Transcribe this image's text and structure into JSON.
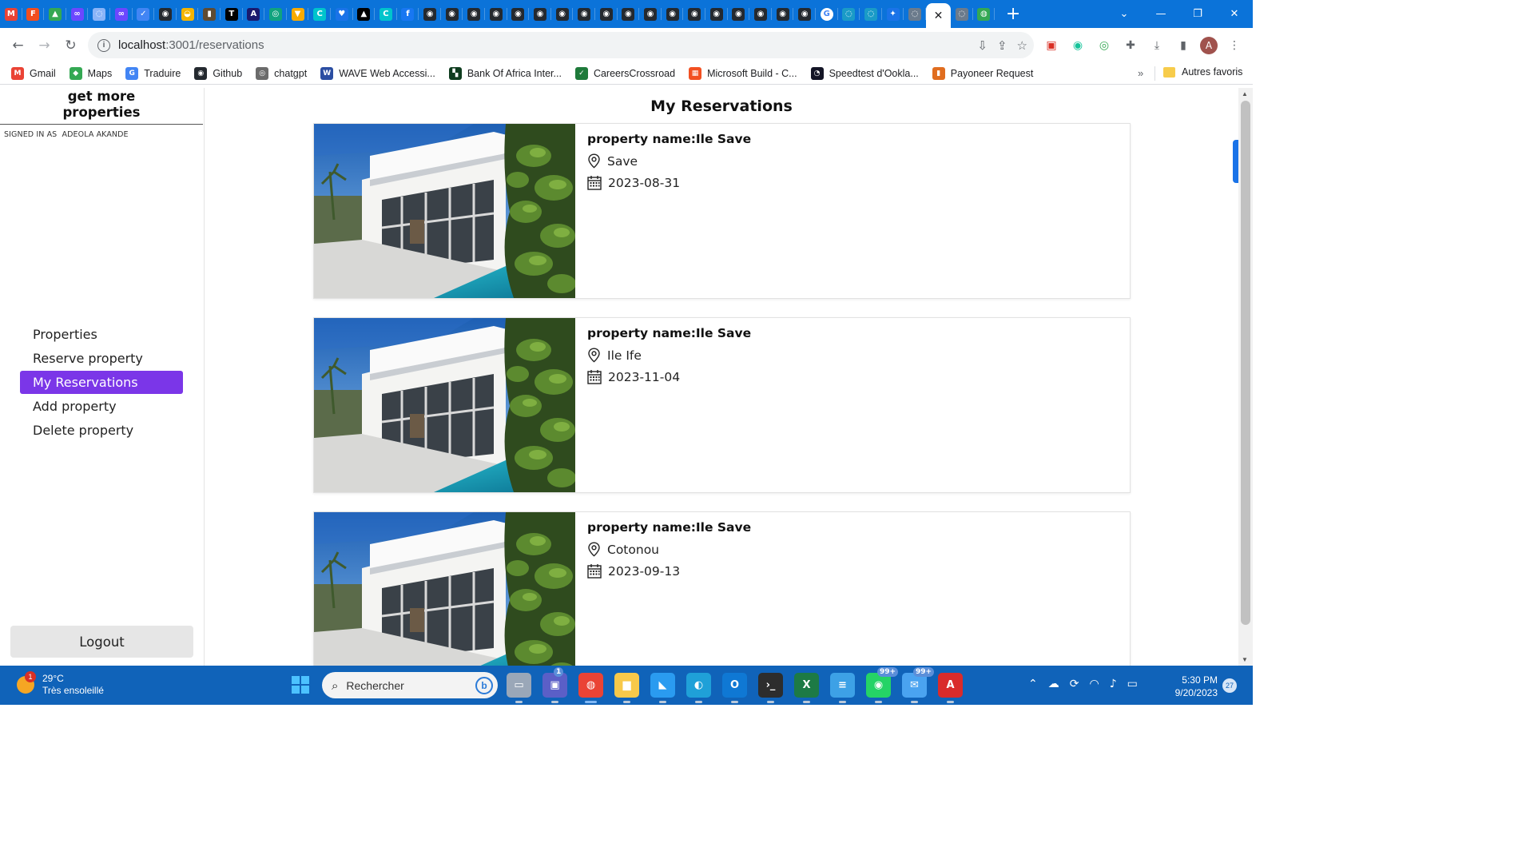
{
  "browser": {
    "url_host": "localhost",
    "url_path": ":3001/reservations",
    "tab_favicons": [
      {
        "icon": "gmail-icon",
        "color": "#ea4335",
        "glyph": "M"
      },
      {
        "icon": "figma-icon",
        "color": "#f24e1e",
        "glyph": "F"
      },
      {
        "icon": "drive-icon",
        "color": "#34a853",
        "glyph": "▲"
      },
      {
        "icon": "meta-icon",
        "color": "#6c47ff",
        "glyph": "∞"
      },
      {
        "icon": "globe-icon",
        "color": "#8ab4f8",
        "glyph": "◌"
      },
      {
        "icon": "meta-icon",
        "color": "#6c47ff",
        "glyph": "∞"
      },
      {
        "icon": "app-icon",
        "color": "#4285f4",
        "glyph": "✓"
      },
      {
        "icon": "github-icon",
        "color": "#24292f",
        "glyph": "◉"
      },
      {
        "icon": "app-icon",
        "color": "#f4b400",
        "glyph": "◒"
      },
      {
        "icon": "book-icon",
        "color": "#5f4b32",
        "glyph": "▮"
      },
      {
        "icon": "text-icon",
        "color": "#000000",
        "glyph": "T"
      },
      {
        "icon": "app-icon",
        "color": "#1a1a6e",
        "glyph": "A"
      },
      {
        "icon": "chatgpt-icon",
        "color": "#10a37f",
        "glyph": "◎"
      },
      {
        "icon": "app-icon",
        "color": "#f9ab00",
        "glyph": "▼"
      },
      {
        "icon": "canva-icon",
        "color": "#00c4cc",
        "glyph": "C"
      },
      {
        "icon": "heart-icon",
        "color": "#1a73e8",
        "glyph": "♥"
      },
      {
        "icon": "app-icon",
        "color": "#000000",
        "glyph": "▲"
      },
      {
        "icon": "canva-icon",
        "color": "#00c4cc",
        "glyph": "C"
      },
      {
        "icon": "facebook-icon",
        "color": "#1877f2",
        "glyph": "f"
      },
      {
        "icon": "github-icon",
        "color": "#24292f",
        "glyph": "◉"
      },
      {
        "icon": "github-icon",
        "color": "#24292f",
        "glyph": "◉"
      },
      {
        "icon": "github-icon",
        "color": "#24292f",
        "glyph": "◉"
      },
      {
        "icon": "github-icon",
        "color": "#24292f",
        "glyph": "◉"
      },
      {
        "icon": "github-icon",
        "color": "#24292f",
        "glyph": "◉"
      },
      {
        "icon": "github-icon",
        "color": "#24292f",
        "glyph": "◉"
      },
      {
        "icon": "github-icon",
        "color": "#24292f",
        "glyph": "◉"
      },
      {
        "icon": "github-icon",
        "color": "#24292f",
        "glyph": "◉"
      },
      {
        "icon": "github-icon",
        "color": "#24292f",
        "glyph": "◉"
      },
      {
        "icon": "github-icon",
        "color": "#24292f",
        "glyph": "◉"
      },
      {
        "icon": "github-icon",
        "color": "#24292f",
        "glyph": "◉"
      },
      {
        "icon": "github-icon",
        "color": "#24292f",
        "glyph": "◉"
      },
      {
        "icon": "github-icon",
        "color": "#24292f",
        "glyph": "◉"
      },
      {
        "icon": "github-icon",
        "color": "#24292f",
        "glyph": "◉"
      },
      {
        "icon": "github-icon",
        "color": "#24292f",
        "glyph": "◉"
      },
      {
        "icon": "github-icon",
        "color": "#24292f",
        "glyph": "◉"
      },
      {
        "icon": "github-icon",
        "color": "#24292f",
        "glyph": "◉"
      },
      {
        "icon": "github-icon",
        "color": "#24292f",
        "glyph": "◉"
      },
      {
        "icon": "google-icon",
        "color": "#ffffff",
        "glyph": "G"
      },
      {
        "icon": "globe-icon",
        "color": "#1a9bc7",
        "glyph": "◌"
      },
      {
        "icon": "globe-icon",
        "color": "#1a9bc7",
        "glyph": "◌"
      },
      {
        "icon": "app-icon",
        "color": "#1a73e8",
        "glyph": "✦"
      },
      {
        "icon": "globe-icon",
        "color": "#6b7b8c",
        "glyph": "◌"
      }
    ],
    "tab_favicons_after": [
      {
        "icon": "globe-icon",
        "color": "#6b7b8c",
        "glyph": "◌"
      },
      {
        "icon": "app-icon",
        "color": "#34a853",
        "glyph": "◍"
      }
    ],
    "active_tab_close": "✕",
    "new_tab": "+",
    "window_controls": {
      "dropdown": "⌄",
      "minimize": "—",
      "restore": "❐",
      "close": "✕"
    },
    "bookmarks": [
      {
        "label": "Gmail",
        "icon": "gmail-icon",
        "color": "#ea4335",
        "glyph": "M"
      },
      {
        "label": "Maps",
        "icon": "maps-icon",
        "color": "#34a853",
        "glyph": "◆"
      },
      {
        "label": "Traduire",
        "icon": "translate-icon",
        "color": "#4285f4",
        "glyph": "G"
      },
      {
        "label": "Github",
        "icon": "github-icon",
        "color": "#24292f",
        "glyph": "◉"
      },
      {
        "label": "chatgpt",
        "icon": "chatgpt-icon",
        "color": "#6b6b6b",
        "glyph": "◎"
      },
      {
        "label": "WAVE Web Accessi...",
        "icon": "wave-icon",
        "color": "#2b4ea2",
        "glyph": "W"
      },
      {
        "label": "Bank Of Africa Inter...",
        "icon": "bank-icon",
        "color": "#0f3d1f",
        "glyph": "▚"
      },
      {
        "label": "CareersCrossroad",
        "icon": "careers-icon",
        "color": "#1e7a3a",
        "glyph": "✓"
      },
      {
        "label": "Microsoft Build - C...",
        "icon": "microsoft-icon",
        "color": "#f25022",
        "glyph": "▦"
      },
      {
        "label": "Speedtest d'Ookla...",
        "icon": "speedtest-icon",
        "color": "#141526",
        "glyph": "◔"
      },
      {
        "label": "Payoneer Request",
        "icon": "payoneer-icon",
        "color": "#e06d1f",
        "glyph": "▮"
      }
    ],
    "bookmarks_more": "»",
    "other_bookmarks": "Autres favoris"
  },
  "app": {
    "brand": "get more properties",
    "signed_in_prefix": "SIGNED IN AS",
    "user_name": "ADEOLA AKANDE",
    "menu": [
      {
        "label": "Properties",
        "active": false
      },
      {
        "label": "Reserve property",
        "active": false
      },
      {
        "label": "My Reservations",
        "active": true
      },
      {
        "label": "Add property",
        "active": false
      },
      {
        "label": "Delete property",
        "active": false
      }
    ],
    "logout_label": "Logout",
    "accent_color": "#7b36e8",
    "page_title": "My Reservations",
    "reservations": [
      {
        "name_prefix": "property name:",
        "name": "Ile Save",
        "city": "Save",
        "date": "2023-08-31"
      },
      {
        "name_prefix": "property name:",
        "name": "Ile Save",
        "city": "Ile Ife",
        "date": "2023-11-04"
      },
      {
        "name_prefix": "property name:",
        "name": "Ile Save",
        "city": "Cotonou",
        "date": "2023-09-13"
      }
    ]
  },
  "taskbar": {
    "weather_badge": "1",
    "temperature": "29°C",
    "condition": "Très ensoleillé",
    "search_placeholder": "Rechercher",
    "apps": [
      {
        "name": "task-view-icon",
        "color": "#9aa7b8",
        "glyph": "▭",
        "running": false
      },
      {
        "name": "teams-icon",
        "color": "#5b5fc7",
        "glyph": "▣",
        "running": false,
        "count": "1"
      },
      {
        "name": "chrome-icon",
        "color": "#ea4335",
        "glyph": "◍",
        "running": true
      },
      {
        "name": "file-explorer-icon",
        "color": "#f8c94a",
        "glyph": "▆",
        "running": false
      },
      {
        "name": "vscode-icon",
        "color": "#2a9bf0",
        "glyph": "◣",
        "running": false
      },
      {
        "name": "edge-icon",
        "color": "#1fa0d8",
        "glyph": "◐",
        "running": false
      },
      {
        "name": "outlook-icon",
        "color": "#0f78d4",
        "glyph": "O",
        "running": false
      },
      {
        "name": "terminal-icon",
        "color": "#2d2d2d",
        "glyph": "›_",
        "running": false
      },
      {
        "name": "excel-icon",
        "color": "#1d7a45",
        "glyph": "X",
        "running": false
      },
      {
        "name": "notepad-icon",
        "color": "#3da1e6",
        "glyph": "≡",
        "running": false
      },
      {
        "name": "whatsapp-icon",
        "color": "#25d366",
        "glyph": "◉",
        "running": false,
        "count": "99+"
      },
      {
        "name": "mail-icon",
        "color": "#4aa3f0",
        "glyph": "✉",
        "running": false,
        "count": "99+"
      },
      {
        "name": "acrobat-icon",
        "color": "#d92b2b",
        "glyph": "A",
        "running": false
      }
    ],
    "time": "5:30 PM",
    "date": "9/20/2023",
    "notifications": "27"
  }
}
